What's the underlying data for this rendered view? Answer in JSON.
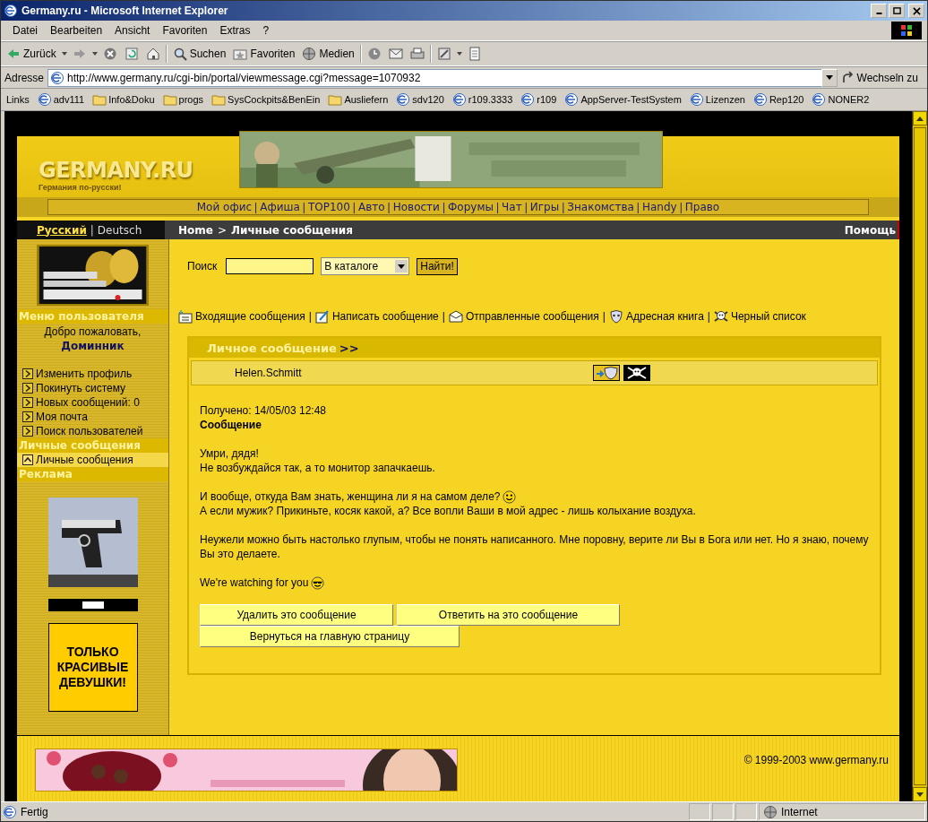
{
  "window": {
    "title": "Germany.ru - Microsoft Internet Explorer"
  },
  "menu_bar": [
    "Datei",
    "Bearbeiten",
    "Ansicht",
    "Favoriten",
    "Extras",
    "?"
  ],
  "toolbar": [
    {
      "kind": "back",
      "label": "Zurück"
    },
    {
      "kind": "forward"
    },
    {
      "kind": "stop"
    },
    {
      "kind": "refresh"
    },
    {
      "kind": "home"
    },
    {
      "kind": "search",
      "label": "Suchen"
    },
    {
      "kind": "favorites",
      "label": "Favoriten"
    },
    {
      "kind": "media",
      "label": "Medien"
    },
    {
      "kind": "history"
    },
    {
      "kind": "mail"
    },
    {
      "kind": "print"
    },
    {
      "kind": "edit"
    },
    {
      "kind": "discuss"
    }
  ],
  "address_bar": {
    "label": "Adresse",
    "url": "http://www.germany.ru/cgi-bin/portal/viewmessage.cgi?message=1070932",
    "go": "Wechseln zu"
  },
  "links_bar": {
    "label": "Links",
    "items": [
      {
        "kind": "page",
        "label": "adv111"
      },
      {
        "kind": "folder",
        "label": "Info&Doku"
      },
      {
        "kind": "folder",
        "label": "progs"
      },
      {
        "kind": "folder",
        "label": "SysCockpits&BenEin"
      },
      {
        "kind": "folder",
        "label": "Ausliefern"
      },
      {
        "kind": "page",
        "label": "sdv120"
      },
      {
        "kind": "page",
        "label": "r109.3333"
      },
      {
        "kind": "page",
        "label": "r109"
      },
      {
        "kind": "page",
        "label": "AppServer-TestSystem"
      },
      {
        "kind": "page",
        "label": "Lizenzen"
      },
      {
        "kind": "page",
        "label": "Rep120"
      },
      {
        "kind": "page",
        "label": "NONER2"
      }
    ]
  },
  "site": {
    "logo": "GERMANY.RU",
    "tagline": "Германия по-русски!",
    "nav_separator": "|",
    "language_separator": "|",
    "breadcrumb_separator": ">",
    "nav": [
      "Мой офис",
      "Афиша",
      "TOP100",
      "Авто",
      "Новости",
      "Форумы",
      "Чат",
      "Игры",
      "Знакомства",
      "Handy",
      "Право"
    ],
    "languages": [
      {
        "label": "Русский",
        "selected": true
      },
      {
        "label": "Deutsch",
        "selected": false
      }
    ],
    "breadcrumb": [
      "Home",
      "Личные сообщения"
    ],
    "help": "Помощь"
  },
  "sidebar": {
    "sections": [
      {
        "title": "Меню пользователя",
        "greeting": "Добро пожаловать,",
        "user": "Доминник",
        "items": [
          {
            "label": "Изменить профиль",
            "selected": false
          },
          {
            "label": "Покинуть систему",
            "selected": false
          },
          {
            "label": "Новых сообщений: 0",
            "selected": false
          },
          {
            "label": "Моя почта",
            "selected": false
          },
          {
            "label": "Поиск пользователей",
            "selected": false
          }
        ]
      },
      {
        "title": "Личные сообщения",
        "items": [
          {
            "label": "Личные сообщения",
            "selected": true
          }
        ]
      },
      {
        "title": "Реклама"
      }
    ],
    "ad_text": "ТОЛЬКО КРАСИВЫЕ ДЕВУШКИ!"
  },
  "search": {
    "label": "Поиск",
    "scope": "В каталоге",
    "button": "Найти!"
  },
  "message_links_separator": "|",
  "message_links": [
    {
      "kind": "inbox",
      "label": "Входящие сообщения"
    },
    {
      "kind": "compose",
      "label": "Написать сообщение"
    },
    {
      "kind": "sent",
      "label": "Отправленные сообщения"
    },
    {
      "kind": "addressbook",
      "label": "Адресная книга"
    },
    {
      "kind": "blacklist",
      "label": "Черный список"
    }
  ],
  "message": {
    "title": "Личное сообщение",
    "title_suffix": ">>",
    "sender": "Helen.Schmitt",
    "received": "Получено: 14/05/03 12:48",
    "heading": "Сообщение",
    "paragraphs": [
      [
        {
          "kind": "plain",
          "text": "Умри, дядя!"
        },
        {
          "kind": "plain",
          "text": "Не возбуждайся так, а то монитор запачкаешь."
        }
      ],
      [
        {
          "kind": "smiley",
          "text": "И вообще, откуда Вам знать, женщина ли я на самом деле?"
        },
        {
          "kind": "plain",
          "text": "А если мужик? Прикиньте, косяк какой, а? Все вопли Ваши в мой адрес - лишь колыхание воздуха."
        }
      ],
      [
        {
          "kind": "plain",
          "text": "Неужели можно быть настолько глупым, чтобы не понять написанного. Мне поровну, верите ли Вы в Бога или нет. Но я знаю, почему Вы это делаете."
        }
      ],
      [
        {
          "kind": "sunglasses",
          "text": "We're watching for you"
        }
      ]
    ],
    "buttons": [
      "Удалить это сообщение",
      "Ответить на это сообщение",
      "Вернуться на главную страницу"
    ]
  },
  "footer": {
    "copyright": "©  1999-2003  www.germany.ru"
  },
  "status_bar": {
    "text": "Fertig",
    "zone": "Internet"
  }
}
